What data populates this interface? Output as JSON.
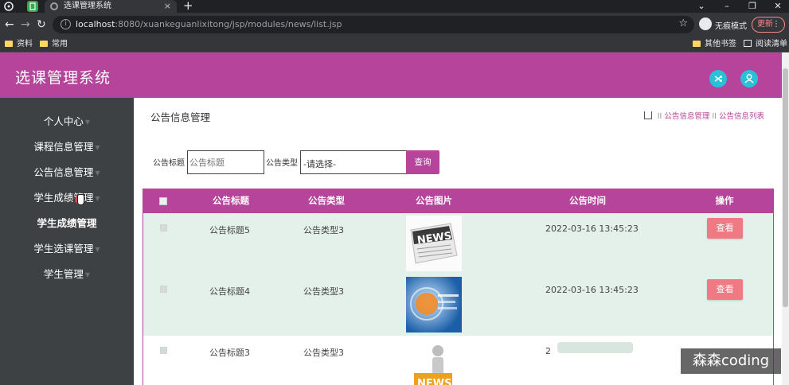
{
  "browser": {
    "tab_title": "选课管理系统",
    "tab_close": "×",
    "new_tab": "+",
    "window_controls": [
      "⌄",
      "–",
      "❐",
      "✕"
    ],
    "url_host": "localhost",
    "url_rest": ":8080/xuankeguanlixitong/jsp/modules/news/list.jsp",
    "incognito_label": "无痕模式",
    "update_label": "更新",
    "bookmarks": [
      "资料",
      "常用"
    ],
    "other_bookmarks": "其他书签",
    "reading_list": "阅读清单"
  },
  "app": {
    "title": "选课管理系统",
    "header_icons": [
      "shuffle-icon",
      "user-icon"
    ],
    "accent_color": "#b5449a",
    "sidebar_color": "#3e4143"
  },
  "sidebar": {
    "items": [
      {
        "label": "个人中心",
        "caret": "▼"
      },
      {
        "label": "课程信息管理",
        "caret": "▼"
      },
      {
        "label": "公告信息管理",
        "caret": "▼"
      },
      {
        "label": "学生成绩管理",
        "caret": "▼"
      },
      {
        "label": "学生成绩管理",
        "caret": ""
      },
      {
        "label": "学生选课管理",
        "caret": "▼"
      },
      {
        "label": "学生管理",
        "caret": "▼"
      }
    ]
  },
  "main": {
    "page_title": "公告信息管理",
    "breadcrumb": [
      "公告信息管理",
      "公告信息列表"
    ],
    "breadcrumb_sep": "II",
    "search": {
      "title_label": "公告标题",
      "title_placeholder": "公告标题",
      "type_label": "公告类型",
      "type_selected": "-请选择-",
      "query_button": "查询"
    },
    "table": {
      "headers": [
        "公告标题",
        "公告类型",
        "公告图片",
        "公告时间",
        "操作"
      ],
      "rows": [
        {
          "title": "公告标题5",
          "type": "公告类型3",
          "image": "news-paper-image",
          "time": "2022-03-16 13:45:23",
          "action": "查看"
        },
        {
          "title": "公告标题4",
          "type": "公告类型3",
          "image": "news-globe-image",
          "time": "2022-03-16 13:45:23",
          "action": "查看"
        },
        {
          "title": "公告标题3",
          "type": "公告类型3",
          "image": "news-figure-image",
          "time": "2",
          "action": ""
        }
      ]
    }
  },
  "watermark": "森森coding"
}
